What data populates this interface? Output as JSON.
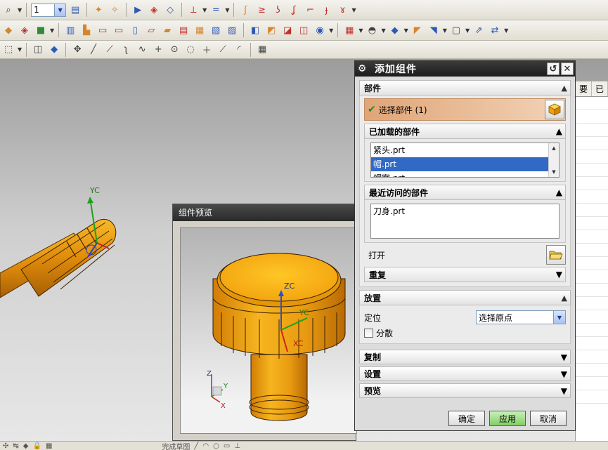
{
  "toolbar": {
    "layer_value": "1"
  },
  "right_table": {
    "headers": [
      "要",
      "已"
    ]
  },
  "status_bar": {
    "finish_sketch_label": "完成草图"
  },
  "preview_window": {
    "title": "组件预览",
    "axis_labels": {
      "zc": "ZC",
      "yc": "YC",
      "xc": "XC",
      "z": "Z",
      "y": "Y",
      "x": "X"
    }
  },
  "viewport": {
    "axis_label_yc": "YC"
  },
  "dialog": {
    "title": "添加组件",
    "parts_section": {
      "header": "部件",
      "select_part_label": "选择部件 (1)",
      "loaded_parts": {
        "header": "已加载的部件",
        "items": [
          "紧头.prt",
          "帽.prt",
          "帽案.prt"
        ],
        "selected_index": 1
      },
      "recent_parts": {
        "header": "最近访问的部件",
        "items": [
          "刀身.prt"
        ]
      },
      "open_label": "打开",
      "repeat_header": "重复"
    },
    "placement_section": {
      "header": "放置",
      "position_label": "定位",
      "position_value": "选择原点",
      "scatter_label": "分散"
    },
    "collapsed_sections": [
      "复制",
      "设置",
      "预览"
    ],
    "buttons": {
      "ok": "确定",
      "apply": "应用",
      "cancel": "取消"
    }
  },
  "colors": {
    "part_orange": "#f2a20f",
    "dialog_title_bar": "#1c1c1c",
    "selection_blue": "#316ac5"
  }
}
